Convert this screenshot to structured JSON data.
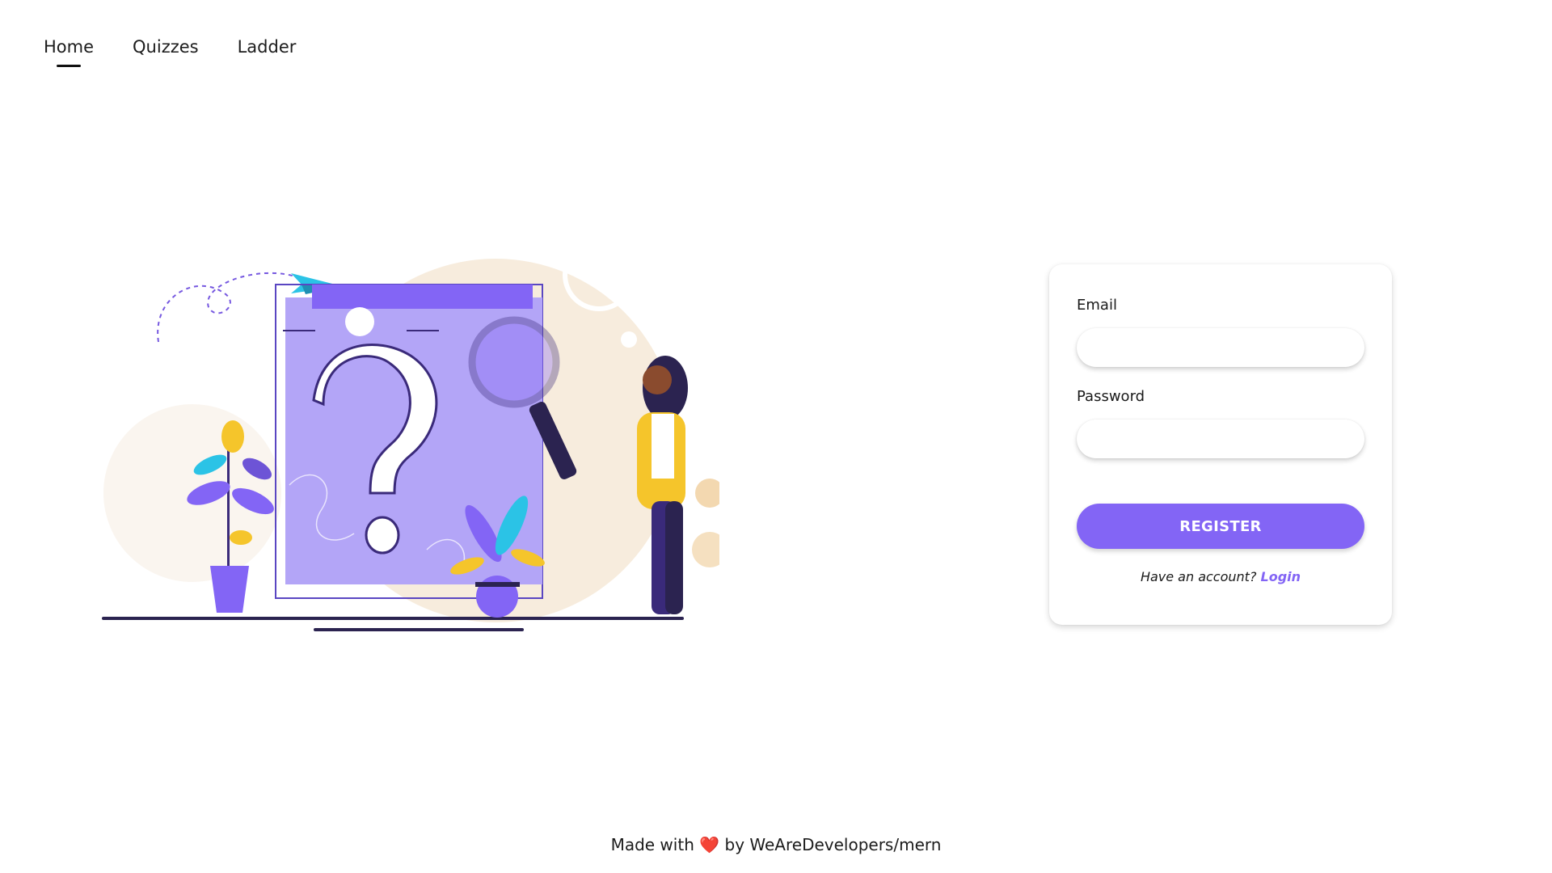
{
  "nav": {
    "items": [
      {
        "label": "Home",
        "active": true
      },
      {
        "label": "Quizzes",
        "active": false
      },
      {
        "label": "Ladder",
        "active": false
      }
    ]
  },
  "illustration": {
    "icon": "question-search-illustration",
    "colors": {
      "purple": "#8365f5",
      "light_purple": "#b3a5f7",
      "dark_purple": "#3a2a7a",
      "yellow": "#f5c52b",
      "beige": "#f5e8d8",
      "cyan": "#2bc3e6"
    }
  },
  "form": {
    "email_label": "Email",
    "email_value": "",
    "password_label": "Password",
    "password_value": "",
    "register_label": "REGISTER",
    "have_account_text": "Have an account?",
    "login_label": "Login"
  },
  "footer": {
    "made_with": "Made with",
    "heart": "❤️",
    "by_text": "by WeAreDevelopers/mern"
  },
  "colors": {
    "accent": "#8365f5"
  }
}
